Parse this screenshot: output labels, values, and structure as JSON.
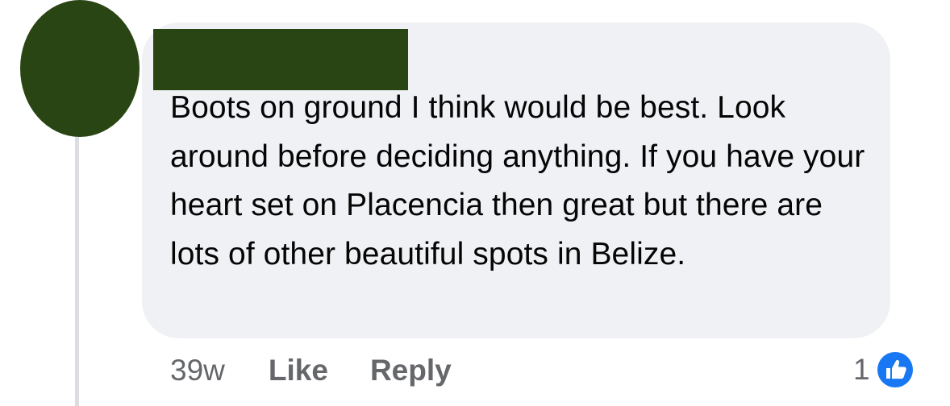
{
  "comment": {
    "text": "Boots on ground I think would be best. Look around before deciding anything. If you have your heart set on Placencia then great but there are lots of other beautiful spots in Belize.",
    "timestamp": "39w",
    "like_label": "Like",
    "reply_label": "Reply",
    "reaction_count": "1",
    "reaction_icon": "thumbs-up-icon"
  },
  "colors": {
    "avatar": "#2a4514",
    "bubble": "#f0f1f4",
    "text": "#050505",
    "meta": "#65676b",
    "like_blue": "#1877f2",
    "thread_line": "#dcdde1"
  }
}
